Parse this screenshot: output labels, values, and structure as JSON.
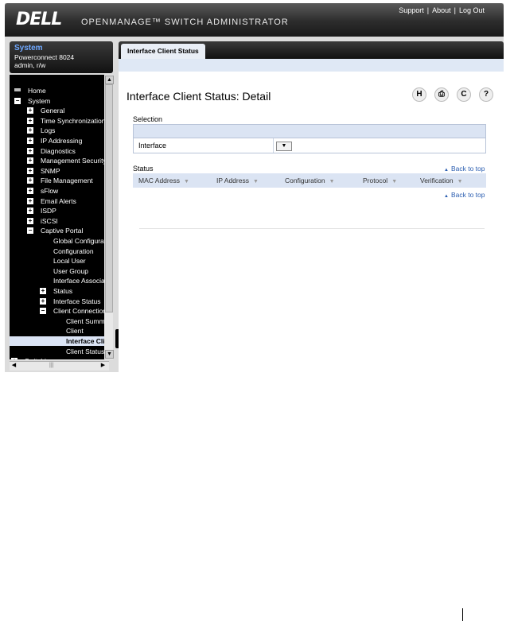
{
  "header": {
    "brand": "DELL",
    "product": "OPENMANAGE™ SWITCH ADMINISTRATOR",
    "links": [
      "Support",
      "About",
      "Log Out"
    ]
  },
  "system": {
    "title": "System",
    "model": "Powerconnect 8024",
    "user": "admin, r/w"
  },
  "tree": [
    {
      "label": "Home",
      "icon": "home-icon",
      "exp": ""
    },
    {
      "label": "System",
      "exp": "-"
    },
    {
      "label": "General",
      "exp": "+"
    },
    {
      "label": "Time Synchronization",
      "exp": "+"
    },
    {
      "label": "Logs",
      "exp": "+"
    },
    {
      "label": "IP Addressing",
      "exp": "+"
    },
    {
      "label": "Diagnostics",
      "exp": "+"
    },
    {
      "label": "Management Security",
      "exp": "+"
    },
    {
      "label": "SNMP",
      "exp": "+"
    },
    {
      "label": "File Management",
      "exp": "+"
    },
    {
      "label": "sFlow",
      "exp": "+"
    },
    {
      "label": "Email Alerts",
      "exp": "+"
    },
    {
      "label": "ISDP",
      "exp": "+"
    },
    {
      "label": "iSCSI",
      "exp": "+"
    },
    {
      "label": "Captive Portal",
      "exp": "-"
    },
    {
      "label": "Global Configuration",
      "exp": ""
    },
    {
      "label": "Configuration",
      "exp": ""
    },
    {
      "label": "Local User",
      "exp": ""
    },
    {
      "label": "User Group",
      "exp": ""
    },
    {
      "label": "Interface Association",
      "exp": ""
    },
    {
      "label": "Status",
      "exp": "+"
    },
    {
      "label": "Interface Status",
      "exp": "+"
    },
    {
      "label": "Client Connection",
      "exp": "-"
    },
    {
      "label": "Client Summary",
      "exp": ""
    },
    {
      "label": "Client",
      "exp": ""
    },
    {
      "label": "Interface Client Status",
      "exp": "",
      "selected": true
    },
    {
      "label": "Client Status",
      "exp": ""
    },
    {
      "label": "Switching",
      "exp": "+"
    }
  ],
  "tab": {
    "label": "Interface Client Status"
  },
  "page": {
    "title": "Interface Client Status: Detail",
    "toolbar": {
      "save": "H",
      "print": "⎙",
      "refresh": "C",
      "help": "?"
    }
  },
  "selection": {
    "label": "Selection",
    "interface_label": "Interface",
    "interface_value": ""
  },
  "status": {
    "label": "Status",
    "back_to_top": "Back to top",
    "columns": [
      "MAC Address",
      "IP Address",
      "Configuration",
      "Protocol",
      "Verification"
    ]
  }
}
